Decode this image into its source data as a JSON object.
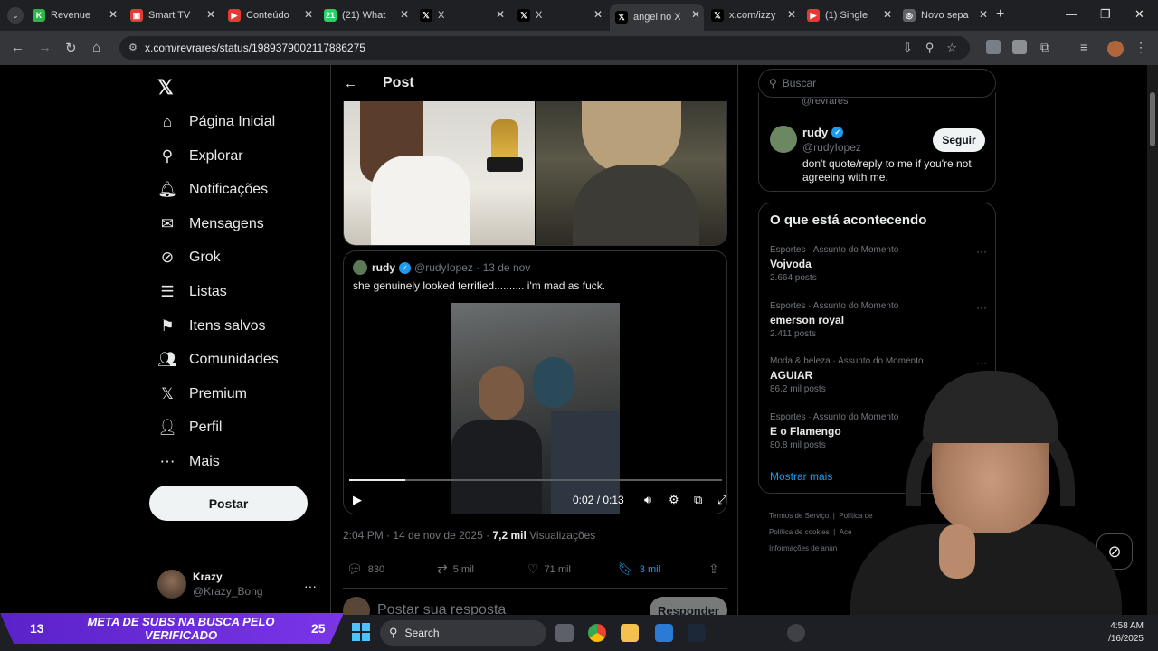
{
  "browser": {
    "tabs": [
      {
        "title": "Revenue",
        "color": "#2fb34a",
        "glyph": "K"
      },
      {
        "title": "Smart TV",
        "color": "#e53935",
        "glyph": "▣"
      },
      {
        "title": "Conteúdo",
        "color": "#e53935",
        "glyph": "▶"
      },
      {
        "title": "(21) What",
        "color": "#25d366",
        "glyph": "21"
      },
      {
        "title": "X",
        "color": "#000000",
        "glyph": "𝕏"
      },
      {
        "title": "X",
        "color": "#000000",
        "glyph": "𝕏"
      },
      {
        "title": "angel no X",
        "color": "#000000",
        "glyph": "𝕏"
      },
      {
        "title": "x.com/izzy",
        "color": "#000000",
        "glyph": "𝕏"
      },
      {
        "title": "(1) Single",
        "color": "#e53935",
        "glyph": "▶"
      },
      {
        "title": "Novo sepa",
        "color": "#5f6368",
        "glyph": "◎"
      }
    ],
    "url": "x.com/revrares/status/1989379002117886275"
  },
  "nav": {
    "logo": "𝕏",
    "items": [
      {
        "label": "Página Inicial",
        "icon": "⌂"
      },
      {
        "label": "Explorar",
        "icon": "⚲"
      },
      {
        "label": "Notificações",
        "icon": "🔔︎"
      },
      {
        "label": "Mensagens",
        "icon": "✉"
      },
      {
        "label": "Grok",
        "icon": "⊘"
      },
      {
        "label": "Listas",
        "icon": "☰"
      },
      {
        "label": "Itens salvos",
        "icon": "⚑"
      },
      {
        "label": "Comunidades",
        "icon": "👥︎"
      },
      {
        "label": "Premium",
        "icon": "𝕏"
      },
      {
        "label": "Perfil",
        "icon": "👤︎"
      },
      {
        "label": "Mais",
        "icon": "⋯"
      }
    ],
    "post_button": "Postar",
    "account": {
      "name": "Krazy",
      "handle": "@Krazy_Bong"
    }
  },
  "main": {
    "header_title": "Post",
    "quote": {
      "name": "rudy",
      "handle": "@rudyIopez",
      "date": "13 de nov",
      "text": "she genuinely looked terrified.......... i'm mad as fuck.",
      "video_time": "0:02 / 0:13",
      "progress": 0.15
    },
    "post_time": "2:04 PM · 14 de nov de 2025 · ",
    "views_count": "7,2 mil",
    "views_label": " Visualizações",
    "actions": {
      "replies": "830",
      "reposts": "5 mil",
      "likes": "71 mil",
      "bookmarks": "3 mil"
    },
    "reply_placeholder": "Postar sua resposta",
    "reply_button": "Responder"
  },
  "right": {
    "search_placeholder": "Buscar",
    "prev_handle": "@revrares",
    "suggestion": {
      "name": "rudy",
      "handle": "@rudyIopez",
      "bio": "don't quote/reply to me if you're not agreeing with me.",
      "follow": "Seguir"
    },
    "trends_title": "O que está acontecendo",
    "trends": [
      {
        "category": "Esportes · Assunto do Momento",
        "name": "Vojvoda",
        "posts": "2.664 posts"
      },
      {
        "category": "Esportes · Assunto do Momento",
        "name": "emerson royal",
        "posts": "2.411 posts"
      },
      {
        "category": "Moda & beleza · Assunto do Momento",
        "name": "AGUIAR",
        "posts": "86,2 mil posts"
      },
      {
        "category": "Esportes · Assunto do Momento",
        "name": "E o Flamengo",
        "posts": "80,8 mil posts"
      }
    ],
    "show_more": "Mostrar mais",
    "footer": [
      "Termos de Serviço",
      "|",
      "Política de",
      "Política de cookies",
      "|",
      "Ace",
      "Informações de anún"
    ]
  },
  "stream": {
    "left_number": "13",
    "banner_text": "META DE SUBS NA BUSCA PELO VERIFICADO",
    "right_number": "25"
  },
  "taskbar": {
    "search": "Search",
    "time": "4:58 AM",
    "date": "/16/2025"
  }
}
